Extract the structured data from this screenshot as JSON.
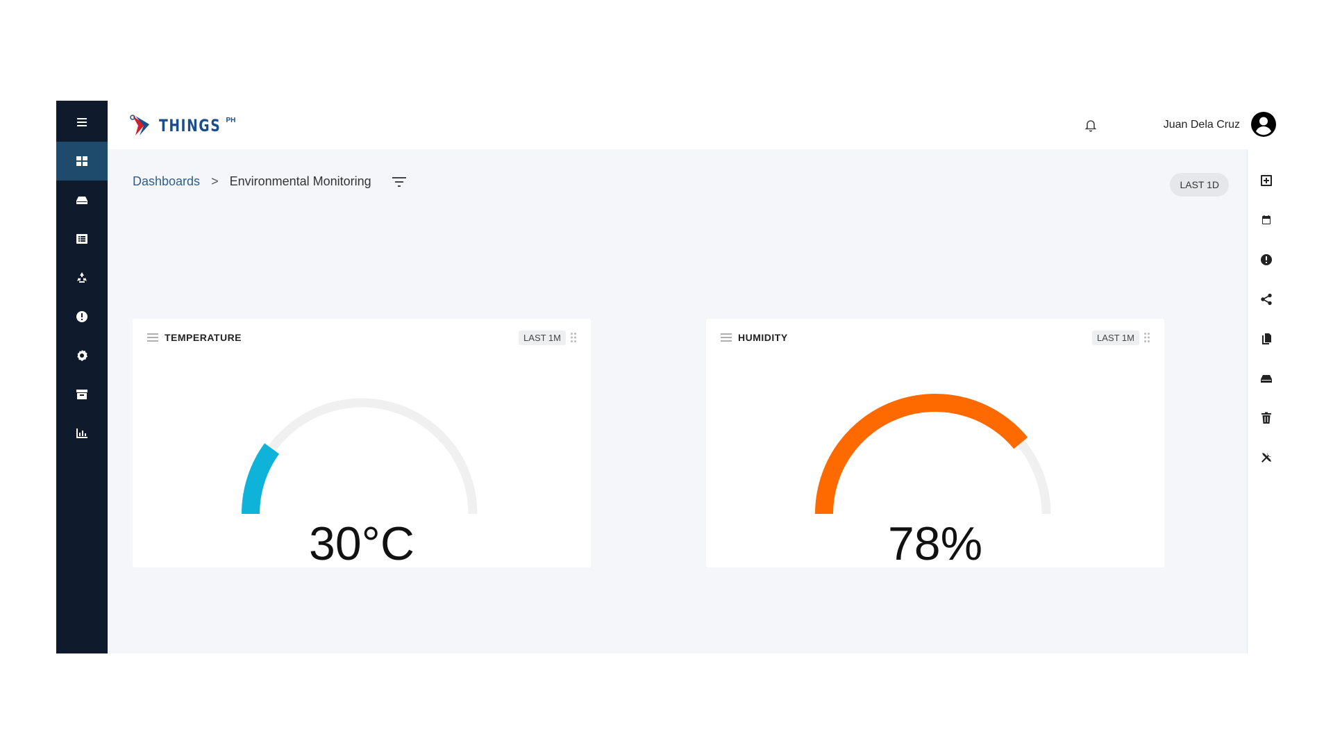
{
  "app": {
    "logo_text": "THINGS",
    "logo_sup": "PH",
    "user_name": "Juan Dela Cruz"
  },
  "sidebar": {
    "items": [
      {
        "icon": "menu-icon"
      },
      {
        "icon": "dashboard-icon",
        "active": true
      },
      {
        "icon": "device-icon"
      },
      {
        "icon": "list-icon"
      },
      {
        "icon": "recycle-icon"
      },
      {
        "icon": "alert-icon"
      },
      {
        "icon": "settings-icon"
      },
      {
        "icon": "archive-icon"
      },
      {
        "icon": "chart-icon"
      }
    ]
  },
  "breadcrumb": {
    "root": "Dashboards",
    "separator": ">",
    "current": "Environmental Monitoring"
  },
  "toolbar": {
    "timewindow": "LAST 1D"
  },
  "widgets": [
    {
      "title": "TEMPERATURE",
      "timewindow": "LAST 1M",
      "display_value": "30°C",
      "fill_fraction": 0.2,
      "color": "#0fb3d9"
    },
    {
      "title": "HUMIDITY",
      "timewindow": "LAST 1M",
      "display_value": "78%",
      "fill_fraction": 0.78,
      "color": "#ff6a00"
    }
  ],
  "right_toolbar": {
    "items": [
      "add-widget-icon",
      "calendar-icon",
      "alert-icon",
      "share-icon",
      "copy-icon",
      "device-icon",
      "delete-icon",
      "tools-icon"
    ]
  },
  "colors": {
    "sidebar_bg": "#0f1a2c",
    "sidebar_active": "#1e4a6b",
    "gauge_track": "#f0f0f0"
  }
}
